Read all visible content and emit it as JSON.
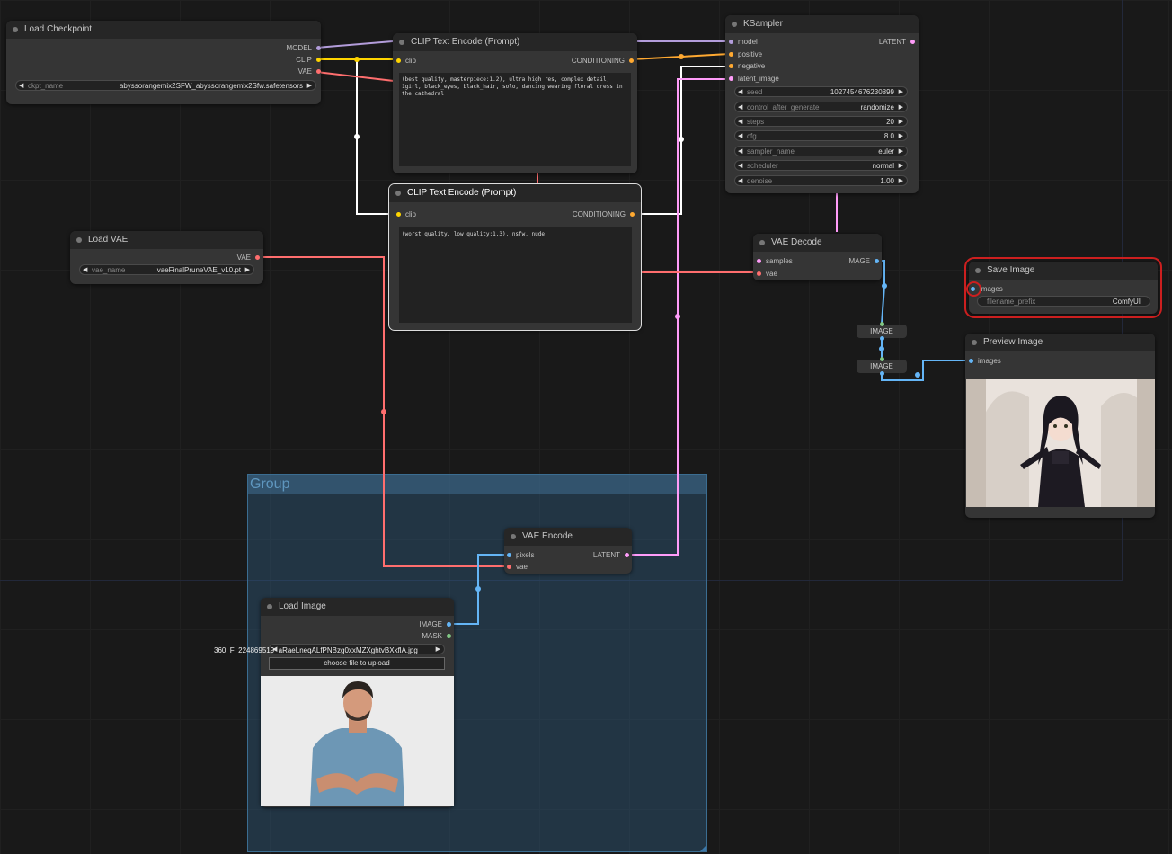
{
  "group": {
    "title": "Group"
  },
  "load_checkpoint": {
    "title": "Load Checkpoint",
    "outputs": [
      "MODEL",
      "CLIP",
      "VAE"
    ],
    "ckpt_label": "ckpt_name",
    "ckpt_value": "abyssorangemix2SFW_abyssorangemix2Sfw.safetensors"
  },
  "clip1": {
    "title": "CLIP Text Encode (Prompt)",
    "input": "clip",
    "output": "CONDITIONING",
    "text": "(best quality, masterpiece:1.2), ultra high res, complex detail, 1girl, black_eyes, black_hair, solo, dancing wearing floral dress in the cathedral"
  },
  "clip2": {
    "title": "CLIP Text Encode (Prompt)",
    "input": "clip",
    "output": "CONDITIONING",
    "text": "(worst quality, low quality:1.3), nsfw, nude"
  },
  "ksampler": {
    "title": "KSampler",
    "inputs": [
      "model",
      "positive",
      "negative",
      "latent_image"
    ],
    "output": "LATENT",
    "widgets": [
      {
        "label": "seed",
        "value": "1027454676230899"
      },
      {
        "label": "control_after_generate",
        "value": "randomize"
      },
      {
        "label": "steps",
        "value": "20"
      },
      {
        "label": "cfg",
        "value": "8.0"
      },
      {
        "label": "sampler_name",
        "value": "euler"
      },
      {
        "label": "scheduler",
        "value": "normal"
      },
      {
        "label": "denoise",
        "value": "1.00"
      }
    ]
  },
  "load_vae": {
    "title": "Load VAE",
    "output": "VAE",
    "label": "vae_name",
    "value": "vaeFinalPruneVAE_v10.pt"
  },
  "vae_decode": {
    "title": "VAE Decode",
    "inputs": [
      "samples",
      "vae"
    ],
    "output": "IMAGE"
  },
  "save_image": {
    "title": "Save Image",
    "input": "images",
    "label": "filename_prefix",
    "value": "ComfyUI"
  },
  "preview_image": {
    "title": "Preview Image",
    "input": "images"
  },
  "reroutes": [
    "IMAGE",
    "IMAGE"
  ],
  "vae_encode": {
    "title": "VAE Encode",
    "inputs": [
      "pixels",
      "vae"
    ],
    "output": "LATENT"
  },
  "load_image": {
    "title": "Load Image",
    "outputs": [
      "IMAGE",
      "MASK"
    ],
    "filename": "360_F_224869519_aRaeLneqALfPNBzg0xxMZXghtvBXkflA.jpg",
    "upload_label": "choose file to upload"
  },
  "colors": {
    "model": "#b39ddb",
    "clip": "#ffd500",
    "vae": "#ff6e6e",
    "conditioning": "#ffa931",
    "latent": "#ff9cf9",
    "image": "#64b5f6",
    "selection": "#cc1f1f"
  }
}
